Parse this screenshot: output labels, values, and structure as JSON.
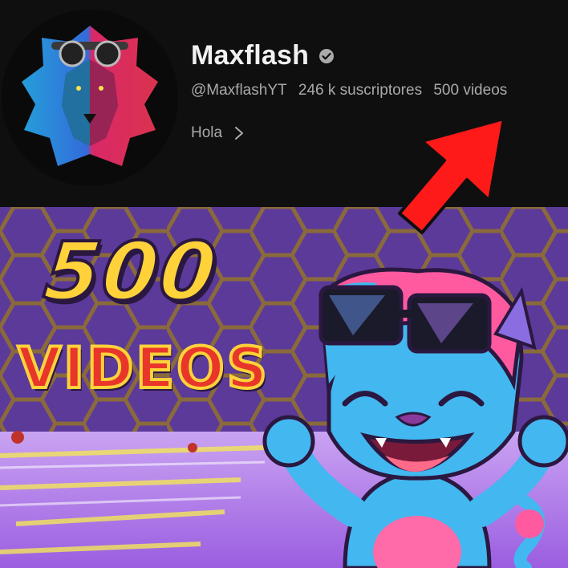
{
  "channel": {
    "name": "Maxflash",
    "handle": "@MaxflashYT",
    "subscribers": "246 k suscriptores",
    "video_count": "500 videos",
    "description": "Hola",
    "verified": true
  },
  "thumbnail": {
    "number_text": "500",
    "word_text": "VIDEOS"
  },
  "icons": {
    "verified": "verified-check-icon",
    "more": "chevron-right-icon",
    "arrow": "arrow-pointer-icon"
  },
  "colors": {
    "header_bg": "#0f0f0f",
    "title_text": "#f1f1f1",
    "secondary_text": "#aaaaaa",
    "arrow_red": "#ff1a1a",
    "number_yellow": "#ffd23a",
    "word_red": "#e8362b",
    "background_purple": "#5b3a9a"
  }
}
